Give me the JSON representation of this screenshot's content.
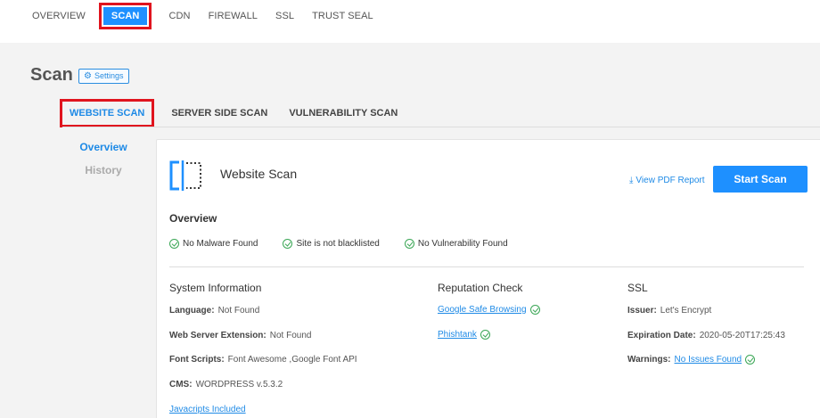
{
  "topnav": {
    "items": [
      "OVERVIEW",
      "SCAN",
      "CDN",
      "FIREWALL",
      "SSL",
      "TRUST SEAL"
    ],
    "active": "SCAN"
  },
  "header": {
    "title": "Scan",
    "settings_label": "Settings"
  },
  "tabs": [
    "WEBSITE SCAN",
    "SERVER SIDE SCAN",
    "VULNERABILITY SCAN"
  ],
  "sidenav": [
    "Overview",
    "History"
  ],
  "panel": {
    "title": "Website Scan",
    "pdf_link": "View PDF Report",
    "start_button": "Start Scan",
    "overview_heading": "Overview",
    "checks": [
      "No Malware Found",
      "Site is not blacklisted",
      "No Vulnerability Found"
    ],
    "system": {
      "heading": "System Information",
      "rows": [
        {
          "label": "Language:",
          "value": "Not Found"
        },
        {
          "label": "Web Server Extension:",
          "value": "Not Found"
        },
        {
          "label": "Font Scripts:",
          "value": "Font Awesome ,Google Font API"
        },
        {
          "label": "CMS:",
          "value": "WORDPRESS v.5.3.2"
        }
      ],
      "js_link": "Javacripts Included"
    },
    "reputation": {
      "heading": "Reputation Check",
      "links": [
        "Google Safe Browsing",
        "Phishtank"
      ]
    },
    "ssl": {
      "heading": "SSL",
      "issuer_label": "Issuer:",
      "issuer_value": "Let's Encrypt",
      "expiration_label": "Expiration Date:",
      "expiration_value": "2020-05-20T17:25:43",
      "warnings_label": "Warnings:",
      "warnings_value": "No Issues Found"
    }
  },
  "colors": {
    "accent": "#1e90ff",
    "highlight": "#e0141e",
    "success": "#3aa655"
  }
}
